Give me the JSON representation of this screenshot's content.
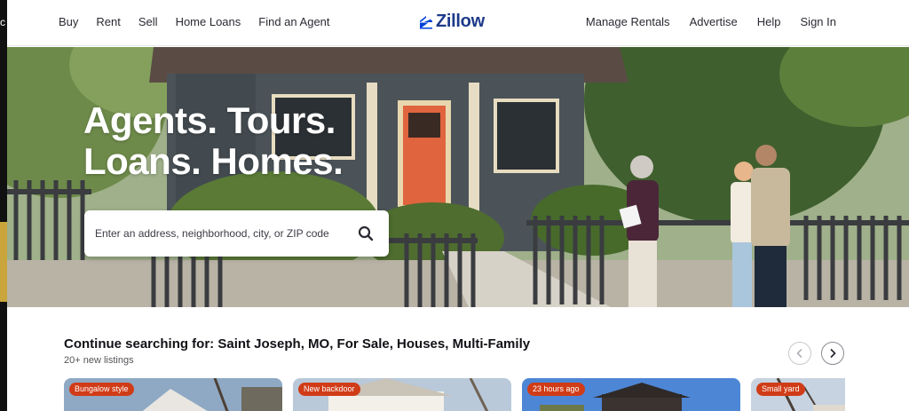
{
  "nav": {
    "left": [
      "Buy",
      "Rent",
      "Sell",
      "Home Loans",
      "Find an Agent"
    ],
    "right": [
      "Manage Rentals",
      "Advertise",
      "Help",
      "Sign In"
    ],
    "logo": "Zillow"
  },
  "hero": {
    "headline_line1": "Agents. Tours.",
    "headline_line2": "Loans. Homes.",
    "search_placeholder": "Enter an address, neighborhood, city, or ZIP code"
  },
  "continue_searching": {
    "title": "Continue searching for: Saint Joseph, MO, For Sale, Houses, Multi-Family",
    "subtitle": "20+ new listings",
    "cards": [
      {
        "badge": "Bungalow style"
      },
      {
        "badge": "New backdoor"
      },
      {
        "badge": "23 hours ago"
      },
      {
        "badge": "Small yard"
      }
    ]
  },
  "left_strip": {
    "char": "c"
  },
  "colors": {
    "brand": "#1d3a8a",
    "badge": "#d03c17",
    "accent_icon": "#0041d9"
  },
  "icons": {
    "search": "search-icon",
    "prev": "chevron-left-icon",
    "next": "chevron-right-icon",
    "logo": "zillow-logo-icon"
  }
}
